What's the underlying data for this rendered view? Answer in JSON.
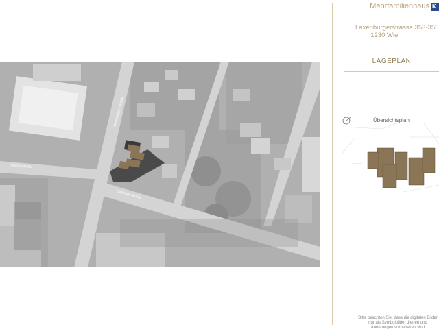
{
  "header": {
    "brand_text": "Mehrfamilienhaus",
    "brand_badge": "K"
  },
  "address": {
    "street": "Laxenburgerstrasse 353-355",
    "city": "1230 Wien"
  },
  "section_title": "LAGEPLAN",
  "overview": {
    "label": "Übersichtsplan"
  },
  "map": {
    "street_labels": [
      "Laxenburger Straße",
      "Draschestraße",
      "Liesinger Straße"
    ],
    "colors": {
      "background": "#b3b3b3",
      "building_highlight": "#8a7556",
      "building_shadow": "#4a4a4a",
      "road": "#d6d6d6"
    }
  },
  "disclaimer": "Bitte beachten Sie, dass die digitalen Bilder nur als Symbolbilder dienen und Änderungen vorbehalten sind"
}
